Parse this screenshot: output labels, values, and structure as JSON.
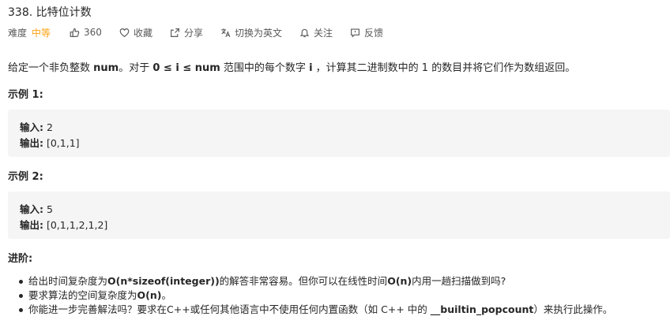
{
  "problem": {
    "title": "338. 比特位计数",
    "difficulty_label": "难度",
    "difficulty_value": "中等",
    "likes": "360",
    "favorite": "收藏",
    "share": "分享",
    "switch_lang": "切换为英文",
    "follow": "关注",
    "feedback": "反馈"
  },
  "description": {
    "p1": "给定一个非负整数 ",
    "num1": "num",
    "p2": "。对于 ",
    "range": "0 ≤ i ≤ num",
    "p3": " 范围中的每个数字 ",
    "i": "i",
    "p4": " ，计算其二进制数中的 1 的数目并将它们作为数组返回。"
  },
  "examples": [
    {
      "heading": "示例 1:",
      "input_label": "输入:",
      "input": " 2",
      "output_label": "输出:",
      "output": " [0,1,1]"
    },
    {
      "heading": "示例 2:",
      "input_label": "输入:",
      "input": " 5",
      "output_label": "输出:",
      "output": " [0,1,1,2,1,2]"
    }
  ],
  "advanced": {
    "heading": "进阶:",
    "items": [
      {
        "a": "给出时间复杂度为",
        "b": "O(n*sizeof(integer))",
        "c": "的解答非常容易。但你可以在线性时间",
        "d": "O(n)",
        "e": "内用一趟扫描做到吗?"
      },
      {
        "a": "要求算法的空间复杂度为",
        "b": "O(n)",
        "c": "。"
      },
      {
        "a": "你能进一步完善解法吗？要求在C++或任何其他语言中不使用任何内置函数（如 C++ 中的 ",
        "b": "__builtin_popcount",
        "c": "）来执行此操作。"
      }
    ]
  }
}
